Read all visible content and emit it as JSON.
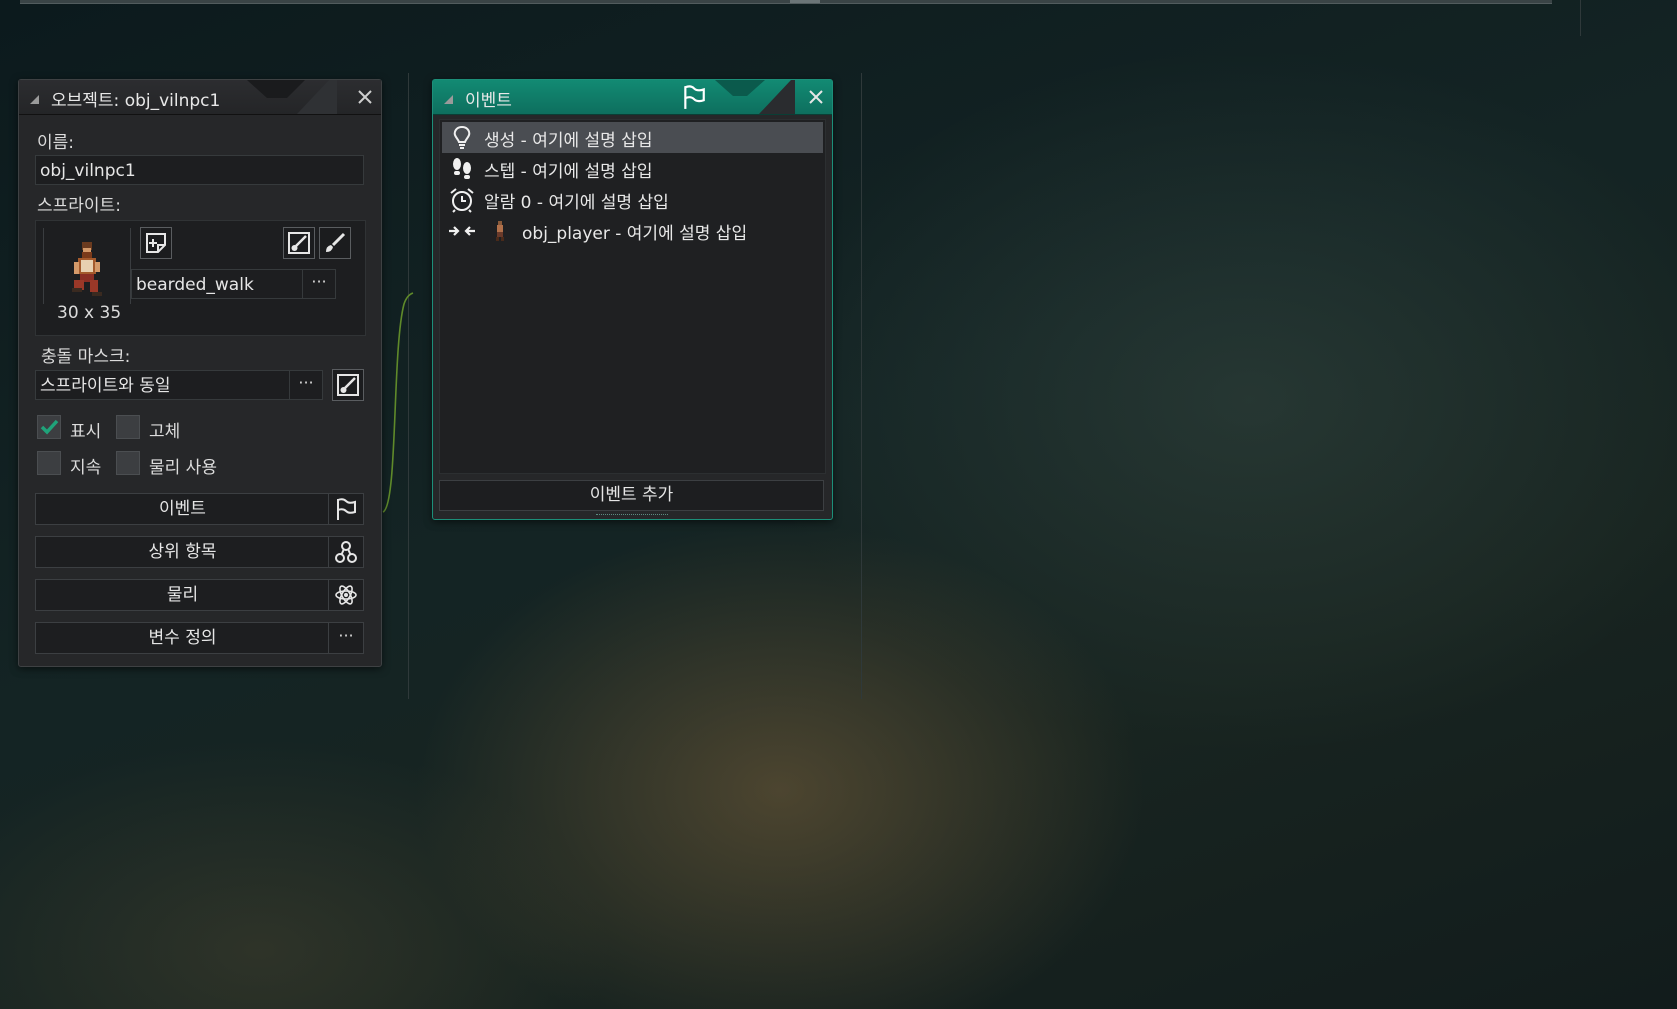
{
  "object_panel": {
    "title": "오브젝트: obj_vilnpc1",
    "name_label": "이름:",
    "name_value": "obj_vilnpc1",
    "sprite_label": "스프라이트:",
    "sprite_name": "bearded_walk",
    "sprite_size": "30 x 35",
    "browse_label": "···",
    "collision_mask_label": "충돌 마스크:",
    "collision_mask_value": "스프라이트와 동일",
    "checkboxes": [
      {
        "label": "표시",
        "checked": true
      },
      {
        "label": "고체",
        "checked": false
      },
      {
        "label": "지속",
        "checked": false
      },
      {
        "label": "물리 사용",
        "checked": false
      }
    ],
    "buttons": [
      {
        "label": "이벤트",
        "icon": "flag-icon"
      },
      {
        "label": "상위 항목",
        "icon": "hierarchy-icon"
      },
      {
        "label": "물리",
        "icon": "atom-icon"
      },
      {
        "label": "변수 정의",
        "icon": "more-icon",
        "icon_text": "···"
      }
    ]
  },
  "events_panel": {
    "title": "이벤트",
    "events": [
      {
        "label": "생성 - 여기에 설명 삽입",
        "icon": "lightbulb-icon",
        "selected": true
      },
      {
        "label": "스텝 - 여기에 설명 삽입",
        "icon": "footsteps-icon",
        "selected": false
      },
      {
        "label": "알람 0 - 여기에 설명 삽입",
        "icon": "alarm-clock-icon",
        "selected": false
      },
      {
        "label": "obj_player - 여기에 설명 삽입",
        "icon": "collision-icon",
        "selected": false
      }
    ],
    "add_event_label": "이벤트 추가"
  },
  "colors": {
    "accent": "#128a73",
    "checkbox_check": "#1fa37a",
    "panel_bg": "#262729",
    "field_bg": "#1d1e20",
    "selected_row": "#4a4d52"
  }
}
